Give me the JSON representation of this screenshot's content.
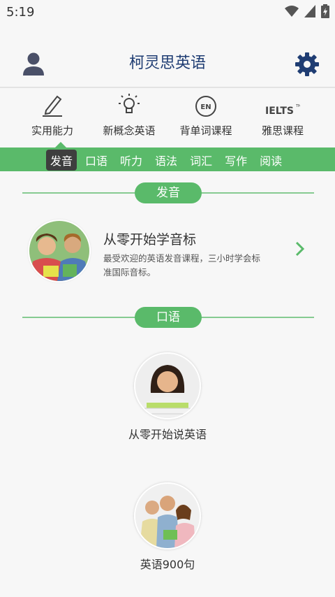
{
  "status_bar": {
    "time": "5:19"
  },
  "header": {
    "title": "柯灵思英语"
  },
  "categories": [
    {
      "label": "实用能力",
      "icon": "pencil-icon"
    },
    {
      "label": "新概念英语",
      "icon": "lightbulb-icon"
    },
    {
      "label": "背单词课程",
      "icon": "en-badge-icon",
      "icon_text": "EN"
    },
    {
      "label": "雅思课程",
      "icon": "ielts-logo-icon",
      "icon_text": "IELTS",
      "icon_mark": "TM"
    }
  ],
  "tabs": [
    {
      "label": "发音",
      "active": true
    },
    {
      "label": "口语"
    },
    {
      "label": "听力"
    },
    {
      "label": "语法"
    },
    {
      "label": "词汇"
    },
    {
      "label": "写作"
    },
    {
      "label": "阅读"
    }
  ],
  "sections": {
    "pronunciation": {
      "title": "发音",
      "course": {
        "title": "从零开始学音标",
        "description": "最受欢迎的英语发音课程，三小时学会标准国际音标。"
      }
    },
    "speaking": {
      "title": "口语",
      "courses": [
        {
          "title": "从零开始说英语"
        },
        {
          "title": "英语900句"
        }
      ]
    }
  },
  "colors": {
    "accent": "#5aba6a",
    "header_title": "#1f3d73",
    "active_tab": "#3e3e3e"
  }
}
